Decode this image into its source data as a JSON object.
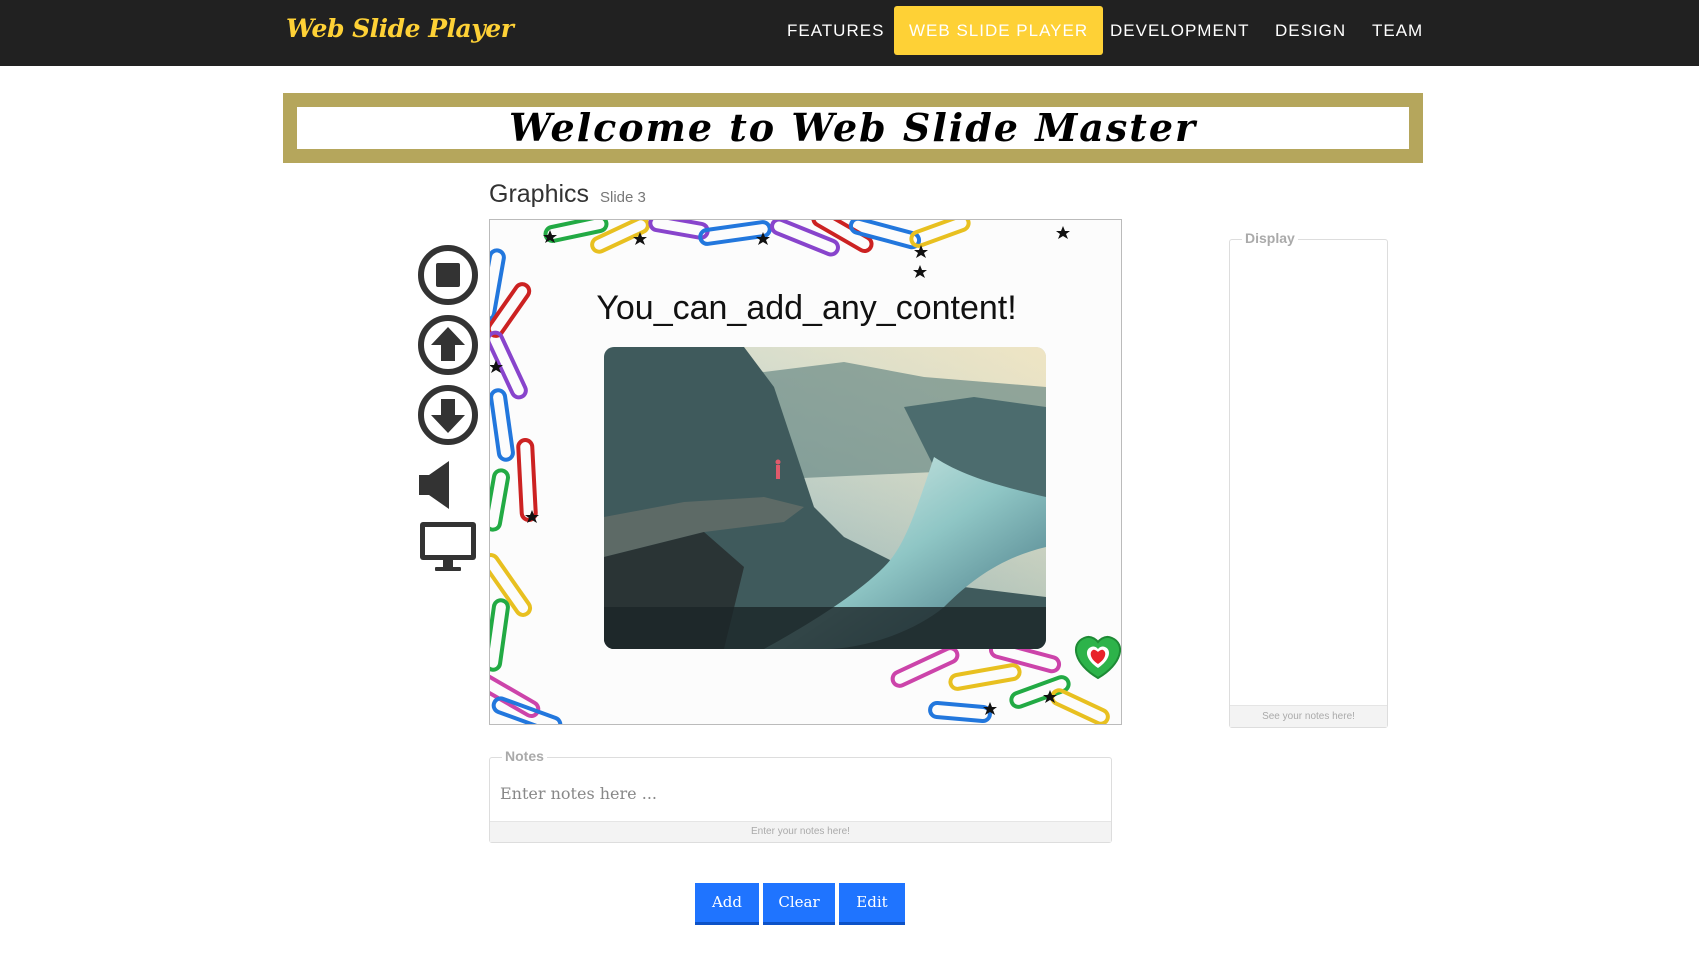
{
  "navbar": {
    "brand": "Web Slide Player",
    "items": [
      {
        "label": "FEATURES",
        "active": false
      },
      {
        "label": "WEB SLIDE PLAYER",
        "active": true
      },
      {
        "label": "DEVELOPMENT",
        "active": false
      },
      {
        "label": "DESIGN",
        "active": false
      },
      {
        "label": "TEAM",
        "active": false
      }
    ]
  },
  "banner": {
    "title": "Welcome to Web Slide Master"
  },
  "slide": {
    "title": "Graphics",
    "number_label": "Slide 3",
    "text": "You_can_add_any_content!"
  },
  "controls": {
    "icons": [
      "stop-icon",
      "arrow-up-icon",
      "arrow-down-icon",
      "volume-icon",
      "monitor-icon"
    ]
  },
  "display_panel": {
    "legend": "Display",
    "footer": "See your notes here!"
  },
  "notes": {
    "legend": "Notes",
    "placeholder": "Enter notes here ...",
    "footer": "Enter your notes here!"
  },
  "buttons": {
    "add": "Add",
    "clear": "Clear",
    "edit": "Edit"
  },
  "colors": {
    "navbar_bg": "#212121",
    "accent": "#fed136",
    "banner_frame": "#b5a65c",
    "button_blue": "#1f74ff"
  }
}
